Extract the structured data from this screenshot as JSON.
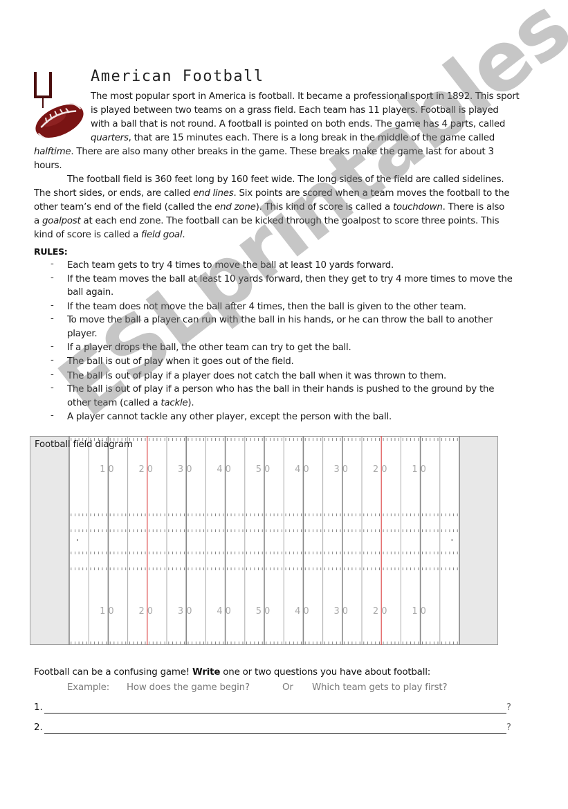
{
  "document": {
    "title": "American Football",
    "icon": "football-goalpost-icon",
    "colors": {
      "icon_maroon": "#7a1414",
      "goalpost": "#4a0d0d",
      "field_redline": "#e05a5a",
      "endzone": "#e8e8e8",
      "watermark": "#8c8c8c"
    },
    "intro_lines": [
      "The most popular sport in America is football. It became a professional sport in 1892. This sport",
      "is played between two teams on a grass field. Each team has 11 players. Football is played",
      "with a ball that is not round. A football is pointed on both ends. The game has 4 parts, called"
    ],
    "intro_line4": {
      "italic": "quarters",
      "rest": ", that are 15 minutes each.  There is a long break in the middle of the game called"
    },
    "intro_line5": {
      "italic": "halftime",
      "rest": ". There are also many other breaks in the game. These breaks make the game last for about 3"
    },
    "intro_line6": "hours.",
    "field_para": {
      "line1": "The football field is 360 feet long by 160 feet wide. The long sides of the field are called sidelines.",
      "line2_a": "The short sides, or ends, are called ",
      "line2_i": "end lines",
      "line2_b": ". Six points are scored when a team moves the football to the",
      "line3_a": "other team’s end of the field (called the ",
      "line3_i": "end zone",
      "line3_b": "). This kind of score is called a ",
      "line3_i2": "touchdown",
      "line3_c": ". There is also",
      "line4_a": "a ",
      "line4_i": "goalpost",
      "line4_b": " at each end zone. The football can be kicked through the goalpost to score three points. This",
      "line5_a": "kind of score is called a ",
      "line5_i": "field goal",
      "line5_b": "."
    },
    "rules_heading": "RULES:",
    "rules": [
      {
        "dash": "-",
        "lines": [
          "Each team gets to try 4 times to move the ball at least 10 yards forward."
        ]
      },
      {
        "dash": "-",
        "lines": [
          "If the team moves the ball at least 10 yards forward, then they get to try 4 more times to move the",
          "ball again."
        ]
      },
      {
        "dash": "-",
        "lines": [
          "If the team does not move the ball after 4 times, then the ball is given to the other team."
        ]
      },
      {
        "dash": "-",
        "lines": [
          "To move the ball a player can run with the ball in his hands, or he can throw the ball to another",
          "player."
        ]
      },
      {
        "dash": "-",
        "lines": [
          "If a player drops the ball, the other team can try to get the ball."
        ]
      },
      {
        "dash": "-",
        "lines": [
          "The ball is out of play when it goes out of the field."
        ]
      },
      {
        "dash": "-",
        "lines": [
          "The ball is out of play if a player does not catch the ball when it was thrown to them."
        ]
      },
      {
        "dash": "-",
        "lines_a": "The ball is out of play if a person who has the ball in their hands is pushed to the ground by the",
        "line2_a": "other team (called a ",
        "line2_i": "tackle",
        "line2_b": ")."
      },
      {
        "dash": "-",
        "lines": [
          "A player cannot tackle any other player, except the person with the ball."
        ]
      }
    ],
    "field_diagram": {
      "label": "Football field diagram",
      "yard_numbers": [
        "10",
        "20",
        "30",
        "40",
        "50",
        "40",
        "30",
        "20",
        "10"
      ],
      "total_yards": 100,
      "stripe_interval_yards": 5,
      "red_lines_at_yards": [
        20,
        80
      ]
    },
    "questions": {
      "intro_a": "Football can be a confusing game! ",
      "intro_bold": "Write",
      "intro_b": " one or two questions you have about football:",
      "example_label": "Example:",
      "example_1": "How does the game begin?",
      "or_label": "Or",
      "example_2": "Which team gets to play first?",
      "answers": [
        {
          "number": "1.",
          "value": "",
          "end": "?"
        },
        {
          "number": "2.",
          "value": "",
          "end": "?"
        }
      ]
    },
    "watermark": "ESLprintables.com"
  }
}
